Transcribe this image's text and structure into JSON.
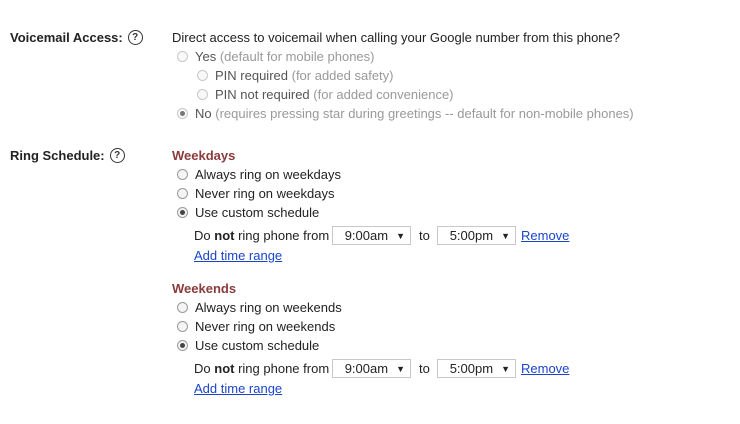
{
  "voicemail": {
    "label": "Voicemail Access:",
    "help": "?",
    "question": "Direct access to voicemail when calling your Google number from this phone?",
    "options": [
      {
        "label": "Yes",
        "note": "(default for mobile phones)",
        "checked": false
      },
      {
        "label": "PIN required",
        "note": "(for added safety)",
        "checked": false
      },
      {
        "label": "PIN not required",
        "note": "(for added convenience)",
        "checked": false
      },
      {
        "label": "No",
        "note": "(requires pressing star during greetings -- default for non-mobile phones)",
        "checked": true
      }
    ]
  },
  "ring_schedule": {
    "label": "Ring Schedule:",
    "help": "?",
    "weekdays": {
      "heading": "Weekdays",
      "options": [
        "Always ring on weekdays",
        "Never ring on weekdays",
        "Use custom schedule"
      ],
      "selected": 2,
      "range_prefix_1": "Do",
      "range_prefix_bold": "not",
      "range_prefix_2": "ring phone from",
      "from": "9:00am",
      "to_label": "to",
      "to": "5:00pm",
      "remove": "Remove",
      "add": "Add time range"
    },
    "weekends": {
      "heading": "Weekends",
      "options": [
        "Always ring on weekends",
        "Never ring on weekends",
        "Use custom schedule"
      ],
      "selected": 2,
      "range_prefix_1": "Do",
      "range_prefix_bold": "not",
      "range_prefix_2": "ring phone from",
      "from": "9:00am",
      "to_label": "to",
      "to": "5:00pm",
      "remove": "Remove",
      "add": "Add time range"
    }
  }
}
